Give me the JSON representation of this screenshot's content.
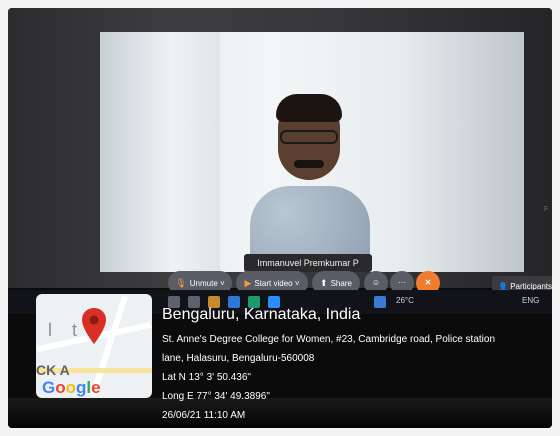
{
  "video": {
    "participant_name": "Immanuvel Premkumar P"
  },
  "toolbar": {
    "unmute_label": "Unmute",
    "start_video_label": "Start video",
    "share_label": "Share",
    "react_icon": "smiley-icon",
    "more_label": "···",
    "leave_label": "✕"
  },
  "participants_label": "Participants",
  "taskbar": {
    "temperature": "26°C",
    "language": "ENG"
  },
  "map": {
    "label_1": "l",
    "label_2": "t",
    "label_cka": "CK A",
    "google": "Google",
    "pin_color": "#d93025"
  },
  "location": {
    "title": "Bengaluru, Karnataka, India",
    "address_1": "St. Anne's Degree College for Women, #23, Cambridge road, Police station",
    "address_2": "lane, Halasuru, Bengaluru-560008",
    "lat": "Lat N 13° 3' 50.436\"",
    "long": "Long E 77° 34' 49.3896\"",
    "datetime": "26/06/21 11:10 AM"
  },
  "colors": {
    "leave_button": "#f07c30",
    "toolbar_button": "#5a5c66"
  }
}
